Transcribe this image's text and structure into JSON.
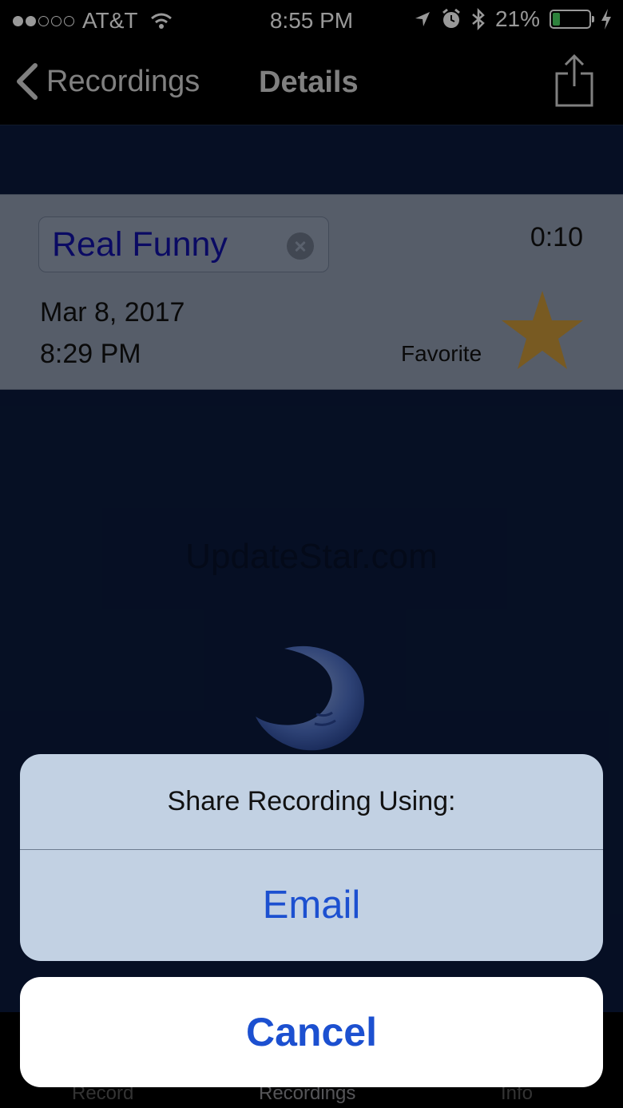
{
  "status_bar": {
    "carrier": "AT&T",
    "time": "8:55 PM",
    "battery_percent": "21%",
    "battery_level": 0.21,
    "signal_bars_filled": 2,
    "signal_bars_total": 5,
    "icons": [
      "wifi-icon",
      "location-icon",
      "alarm-icon",
      "bluetooth-icon",
      "battery-icon",
      "charging-icon"
    ]
  },
  "nav": {
    "back_label": "Recordings",
    "title": "Details",
    "share_icon": "share-icon"
  },
  "recording": {
    "name": "Real Funny",
    "duration": "0:10",
    "date": "Mar 8,  2017",
    "time": "8:29 PM",
    "favorite_label": "Favorite",
    "favorite_color": "#c8963a"
  },
  "watermark": "UpdateStar.com",
  "tabs": [
    {
      "label": "Record"
    },
    {
      "label": "Recordings"
    },
    {
      "label": "Info"
    }
  ],
  "action_sheet": {
    "title": "Share Recording Using:",
    "options": [
      {
        "label": "Email"
      }
    ],
    "cancel_label": "Cancel",
    "accent_color": "#1c50d0"
  }
}
